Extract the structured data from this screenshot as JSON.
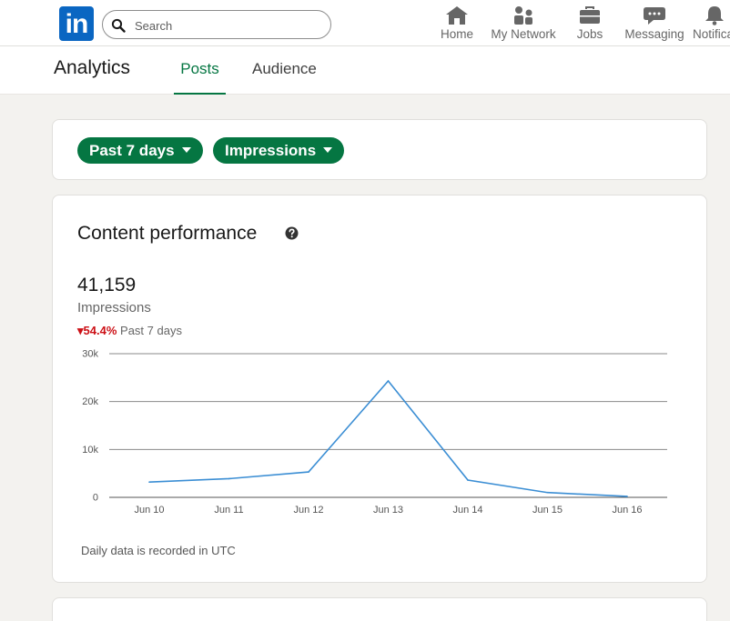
{
  "nav": {
    "logo_text": "in",
    "search_placeholder": "Search",
    "items": [
      {
        "label": "Home",
        "icon": "home-icon"
      },
      {
        "label": "My Network",
        "icon": "network-icon"
      },
      {
        "label": "Jobs",
        "icon": "briefcase-icon"
      },
      {
        "label": "Messaging",
        "icon": "messaging-icon"
      },
      {
        "label": "Notifica",
        "icon": "bell-icon"
      }
    ]
  },
  "subnav": {
    "title": "Analytics",
    "tabs": [
      {
        "label": "Posts",
        "active": true
      },
      {
        "label": "Audience",
        "active": false
      }
    ]
  },
  "filters": {
    "period": "Past 7 days",
    "metric": "Impressions"
  },
  "performance": {
    "title": "Content performance",
    "total": "41,159",
    "metric_label": "Impressions",
    "change_arrow": "▾",
    "change_value": "54.4%",
    "change_period": "Past 7 days",
    "footnote": "Daily data is recorded in UTC"
  },
  "chart_data": {
    "type": "line",
    "categories": [
      "Jun 10",
      "Jun 11",
      "Jun 12",
      "Jun 13",
      "Jun 14",
      "Jun 15",
      "Jun 16"
    ],
    "series": [
      {
        "values": [
          3200,
          3900,
          5300,
          24300,
          3600,
          1000,
          200
        ]
      }
    ],
    "ylim": [
      0,
      30000
    ],
    "yticks": [
      0,
      10000,
      20000,
      30000
    ],
    "ytick_labels": [
      "0",
      "10k",
      "20k",
      "30k"
    ],
    "grid": true,
    "line_color": "#3b8ed4"
  },
  "colors": {
    "brand": "#0a66c2",
    "accent": "#057642",
    "negative": "#cc1016"
  }
}
